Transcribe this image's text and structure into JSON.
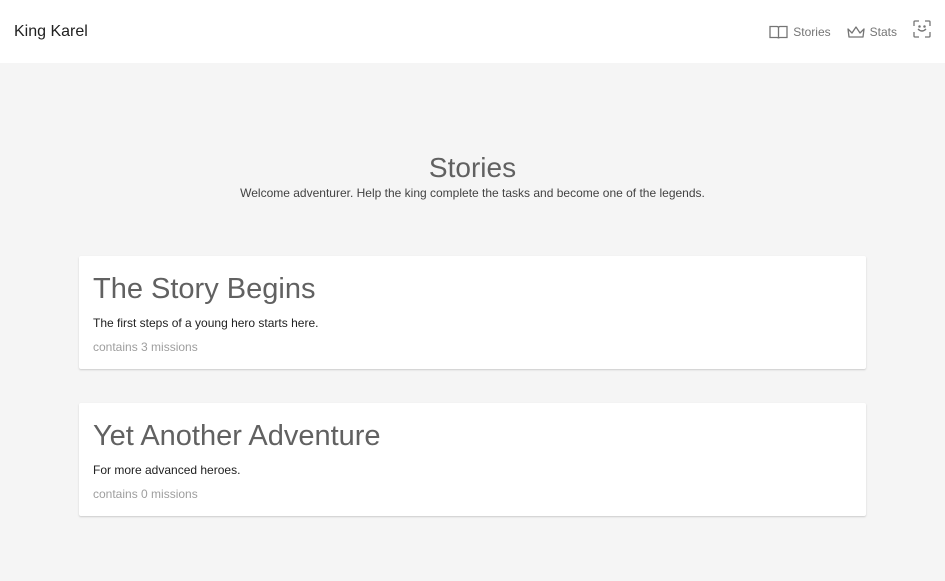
{
  "header": {
    "brand": "King Karel",
    "nav": {
      "stories_label": "Stories",
      "stats_label": "Stats"
    }
  },
  "hero": {
    "title": "Stories",
    "subtitle": "Welcome adventurer. Help the king complete the tasks and become one of the legends."
  },
  "stories": [
    {
      "title": "The Story Begins",
      "description": "The first steps of a young hero starts here.",
      "missions": "contains 3 missions"
    },
    {
      "title": "Yet Another Adventure",
      "description": "For more advanced heroes.",
      "missions": "contains 0 missions"
    }
  ],
  "icons": {
    "stories": "book-open-icon",
    "stats": "crown-icon",
    "fullscreen": "fullscreen-icon"
  }
}
